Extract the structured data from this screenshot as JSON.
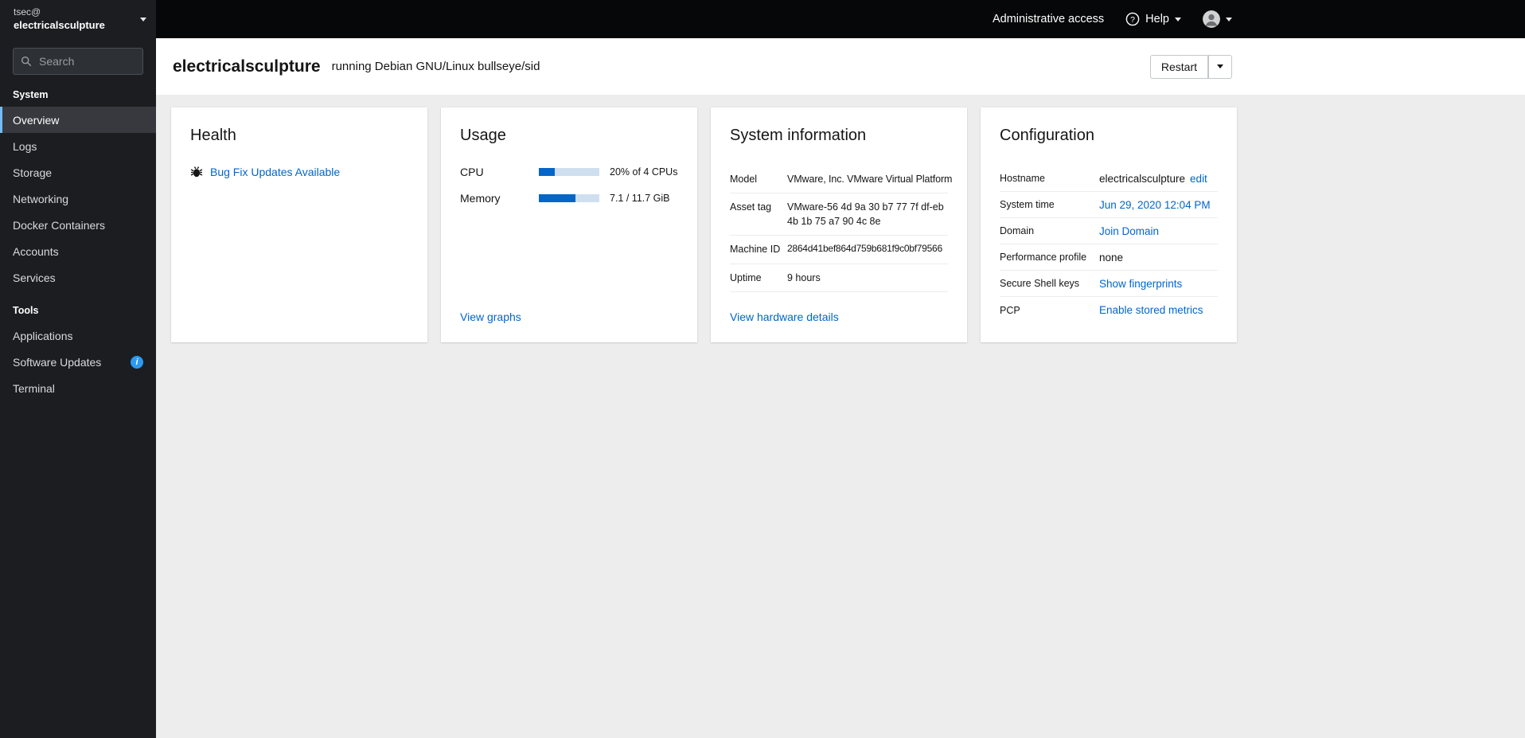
{
  "colors": {
    "accent": "#0066cc",
    "progress_fill": "#0566c9",
    "nav_active_border": "#73bcf7",
    "info_badge": "#2b9af3"
  },
  "topbar": {
    "admin_access_label": "Administrative access",
    "help_label": "Help"
  },
  "sidebar": {
    "user": {
      "line1": "tsec@",
      "line2": "electricalsculpture"
    },
    "search_placeholder": "Search",
    "sections": [
      {
        "title": "System",
        "items": [
          {
            "label": "Overview",
            "active": true
          },
          {
            "label": "Logs"
          },
          {
            "label": "Storage"
          },
          {
            "label": "Networking"
          },
          {
            "label": "Docker Containers"
          },
          {
            "label": "Accounts"
          },
          {
            "label": "Services"
          }
        ]
      },
      {
        "title": "Tools",
        "items": [
          {
            "label": "Applications"
          },
          {
            "label": "Software Updates",
            "info_badge": true
          },
          {
            "label": "Terminal"
          }
        ]
      }
    ]
  },
  "masthead": {
    "hostname": "electricalsculpture",
    "os_label": "running Debian GNU/Linux bullseye/sid",
    "restart_label": "Restart"
  },
  "cards": {
    "health": {
      "title": "Health",
      "update_link": "Bug Fix Updates Available"
    },
    "usage": {
      "title": "Usage",
      "rows": [
        {
          "label": "CPU",
          "value": "20% of 4 CPUs",
          "percent": 26
        },
        {
          "label": "Memory",
          "value": "7.1 / 11.7 GiB",
          "percent": 61
        }
      ],
      "footer_link": "View graphs"
    },
    "system_info": {
      "title": "System information",
      "rows": [
        {
          "label": "Model",
          "value": "VMware, Inc. VMware Virtual Platform"
        },
        {
          "label": "Asset tag",
          "value": "VMware-56 4d 9a 30 b7 77 7f df-eb 4b 1b 75 a7 90 4c 8e"
        },
        {
          "label": "Machine ID",
          "value": "2864d41bef864d759b681f9c0bf79566"
        },
        {
          "label": "Uptime",
          "value": "9 hours"
        }
      ],
      "footer_link": "View hardware details"
    },
    "configuration": {
      "title": "Configuration",
      "rows": [
        {
          "label": "Hostname",
          "value": "electricalsculpture",
          "link": "edit"
        },
        {
          "label": "System time",
          "link": "Jun 29, 2020 12:04 PM"
        },
        {
          "label": "Domain",
          "link": "Join Domain"
        },
        {
          "label": "Performance profile",
          "value": "none"
        },
        {
          "label": "Secure Shell keys",
          "link": "Show fingerprints"
        },
        {
          "label": "PCP",
          "link": "Enable stored metrics"
        }
      ]
    }
  }
}
